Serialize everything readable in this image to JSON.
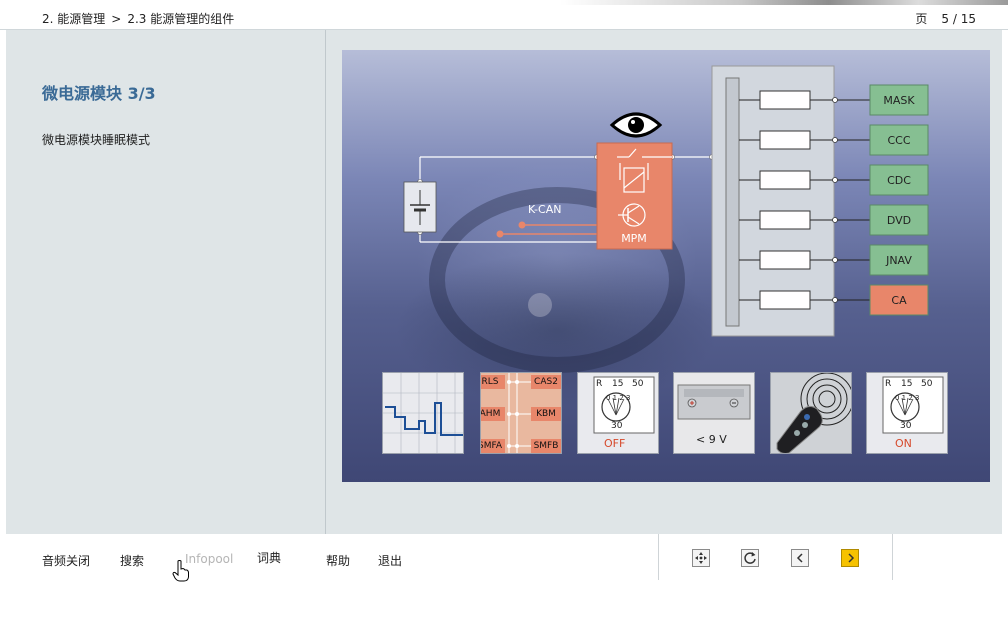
{
  "header": {
    "breadcrumb_section": "2. 能源管理",
    "breadcrumb_separator": ">",
    "breadcrumb_page": "2.3 能源管理的组件",
    "page_label": "页",
    "page_number": "5 / 15"
  },
  "main": {
    "title": "微电源模块 3/3",
    "subtitle": "微电源模块睡眠模式"
  },
  "diagram": {
    "kcan_label": "K-CAN",
    "mpm_label": "MPM",
    "modules": [
      "MASK",
      "CCC",
      "CDC",
      "DVD",
      "JNAV",
      "CA"
    ],
    "module_colors": [
      "#86bf92",
      "#86bf92",
      "#86bf92",
      "#86bf92",
      "#86bf92",
      "#e8866a"
    ],
    "mpm_color": "#e8866a",
    "icons": [
      "eye-icon",
      "battery-icon",
      "relay-icon",
      "transistor-icon"
    ]
  },
  "thumbnails": {
    "relays": [
      "RLS",
      "CAS2",
      "AHM",
      "KBM",
      "SMFA",
      "SMFB"
    ],
    "switch_off": {
      "r": "R",
      "n15": "15",
      "n50": "50",
      "n30": "30",
      "digits": "0 1 2 3",
      "state": "OFF"
    },
    "battery_voltage": "< 9 V",
    "switch_on": {
      "r": "R",
      "n15": "15",
      "n50": "50",
      "n30": "30",
      "digits": "0 1 2 3",
      "state": "ON"
    },
    "state_off_color": "#d64a2c",
    "state_on_color": "#d64a2c"
  },
  "footer": {
    "audio_off": "音频关闭",
    "search": "搜索",
    "infopool": "Infopool",
    "glossary": "词典",
    "help": "帮助",
    "exit": "退出",
    "nav_icons": [
      "overview-icon",
      "reload-icon",
      "prev-icon",
      "next-icon"
    ]
  }
}
